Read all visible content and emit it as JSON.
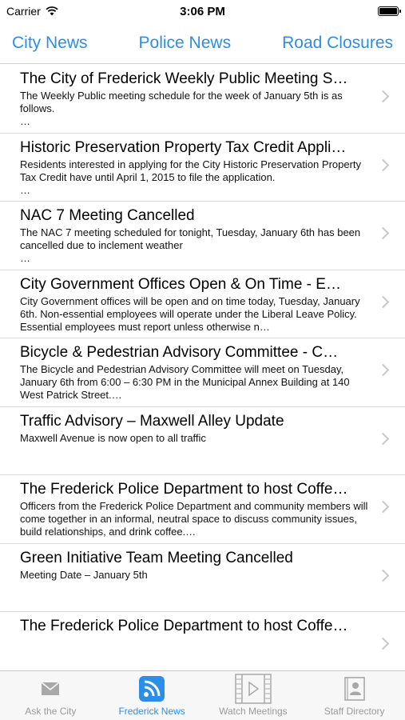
{
  "status_bar": {
    "carrier": "Carrier",
    "time": "3:06 PM"
  },
  "tabs": [
    {
      "label": "City News"
    },
    {
      "label": "Police News"
    },
    {
      "label": "Road Closures"
    }
  ],
  "news": [
    {
      "title": "The City of Frederick Weekly Public Meeting S…",
      "summary": "The Weekly Public meeting schedule for the week of January 5th is as follows.\n              …"
    },
    {
      "title": "Historic Preservation Property Tax Credit Appli…",
      "summary": "Residents interested in applying for the City Historic Preservation Property Tax Credit have until April 1, 2015 to file the application.\n              …"
    },
    {
      "title": "NAC 7 Meeting Cancelled",
      "summary": "The NAC 7 meeting scheduled for tonight, Tuesday, January 6th has been cancelled due to inclement weather\n              …"
    },
    {
      "title": "City Government Offices Open & On Time - E…",
      "summary": "City Government offices will be open and on time today, Tuesday, January 6th. Non-essential employees will operate under the Liberal Leave Policy.  Essential employees must report unless otherwise n…"
    },
    {
      "title": "Bicycle & Pedestrian Advisory Committee  - C…",
      "summary": "The Bicycle and Pedestrian Advisory Committee will meet on Tuesday, January 6th from 6:00 – 6:30 PM in the Municipal Annex Building at 140 West Patrick Street.…"
    },
    {
      "title": "Traffic Advisory – Maxwell Alley Update",
      "summary": "Maxwell Avenue is now open to all traffic"
    },
    {
      "title": "The Frederick Police Department to host Coffe…",
      "summary": "Officers from the Frederick Police Department and community members will come together in an informal, neutral space to discuss community issues, build relationships, and drink coffee.…"
    },
    {
      "title": "Green Initiative Team Meeting Cancelled",
      "summary": "Meeting Date – January 5th"
    },
    {
      "title": "The Frederick Police Department to host Coffe…",
      "summary": ""
    }
  ],
  "tabbar": [
    {
      "label": "Ask the City",
      "icon": "envelope-icon"
    },
    {
      "label": "Frederick News",
      "icon": "rss-icon"
    },
    {
      "label": "Watch Meetings",
      "icon": "film-play-icon"
    },
    {
      "label": "Staff Directory",
      "icon": "contact-card-icon"
    }
  ],
  "colors": {
    "accent": "#2b8ee8",
    "inactive": "#9a9a9a"
  }
}
